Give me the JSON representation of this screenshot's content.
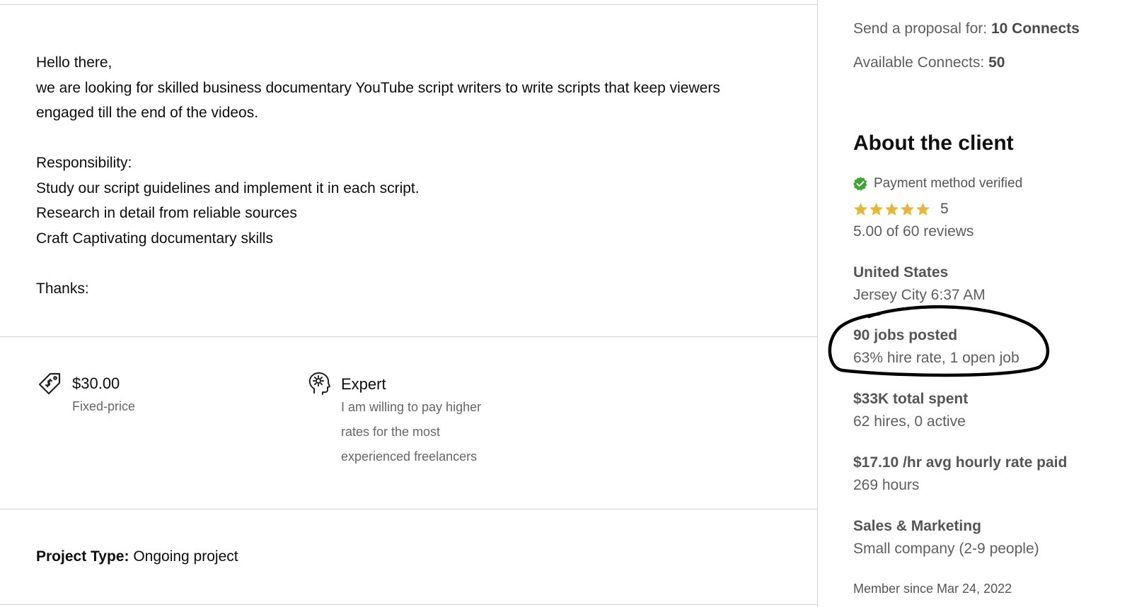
{
  "description": {
    "greeting": "Hello there,",
    "line1": "we are looking for skilled business documentary YouTube script writers to write scripts that keep viewers",
    "line2": "engaged till the end of the videos.",
    "responsibility_heading": "Responsibility:",
    "resp1": "Study our script guidelines and implement it in each script.",
    "resp2": "Research in detail from reliable sources",
    "resp3": "Craft Captivating documentary skills",
    "thanks": "Thanks:"
  },
  "budget": {
    "amount": "$30.00",
    "type": "Fixed-price",
    "icon": "price-tag-icon"
  },
  "experience": {
    "level": "Expert",
    "desc1": "I am willing to pay higher",
    "desc2": "rates for the most",
    "desc3": "experienced freelancers",
    "icon": "gear-head-icon"
  },
  "project_type": {
    "label": "Project Type:",
    "value": "Ongoing project"
  },
  "sidebar": {
    "proposal_label": "Send a proposal for:",
    "proposal_value": "10 Connects",
    "available_label": "Available Connects:",
    "available_value": "50"
  },
  "client": {
    "heading": "About the client",
    "payment": "Payment method verified",
    "rating": "5",
    "rating_fraction": 1.0,
    "reviews": "5.00 of 60 reviews",
    "country": "United States",
    "city_time": "Jersey City 6:37 AM",
    "jobs_posted": "90 jobs posted",
    "hire_rate": "63% hire rate, 1 open job",
    "total_spent": "$33K total spent",
    "hires": "62 hires, 0 active",
    "avg_rate": "$17.10 /hr avg hourly rate paid",
    "hours": "269 hours",
    "industry": "Sales & Marketing",
    "company_size": "Small company (2-9 people)",
    "member_since": "Member since Mar 24, 2022"
  },
  "colors": {
    "verified_green": "#3fa535",
    "star_gold": "#e6b935",
    "annotation": "#000000"
  }
}
